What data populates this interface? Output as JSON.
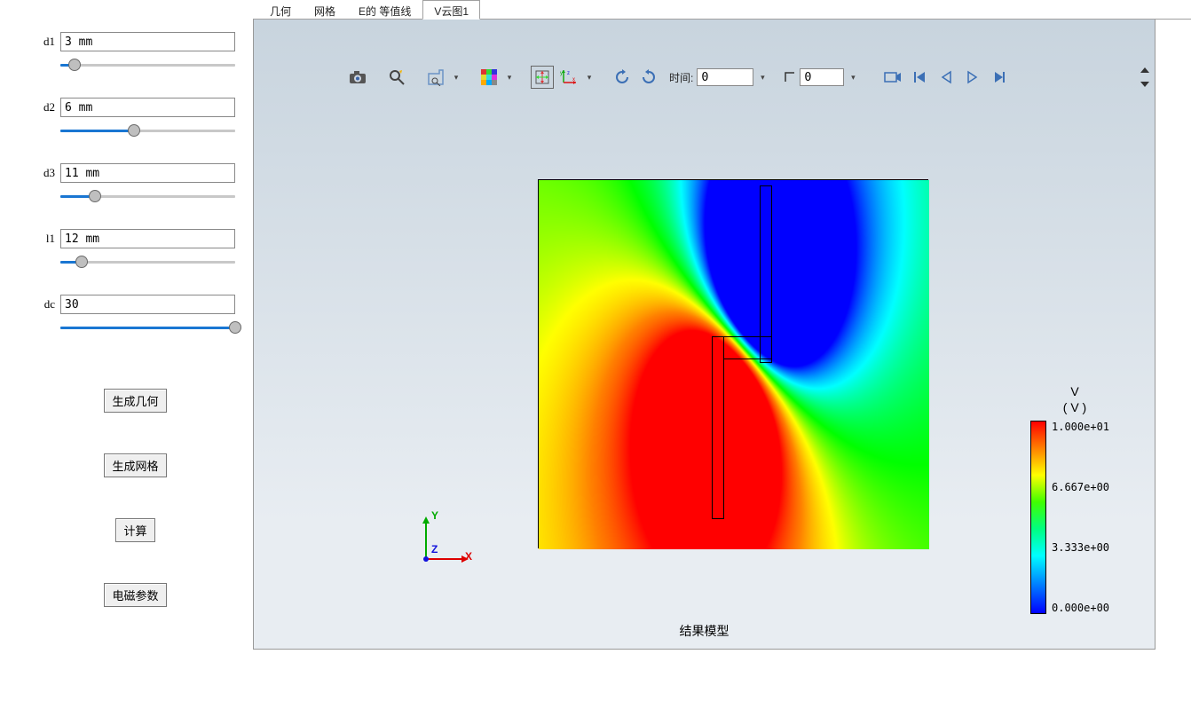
{
  "sidebar": {
    "params": [
      {
        "label": "d1",
        "value": "3 mm",
        "percent": 8
      },
      {
        "label": "d2",
        "value": "6 mm",
        "percent": 42
      },
      {
        "label": "d3",
        "value": "11 mm",
        "percent": 20
      },
      {
        "label": "l1",
        "value": "12 mm",
        "percent": 12
      },
      {
        "label": "dc",
        "value": "30",
        "percent": 100
      }
    ],
    "buttons": {
      "gen_geom": "生成几何",
      "gen_mesh": "生成网格",
      "compute": "计算",
      "em_params": "电磁参数"
    }
  },
  "tabs": [
    {
      "label": "几何",
      "active": false
    },
    {
      "label": "网格",
      "active": false
    },
    {
      "label": "E的 等值线",
      "active": false
    },
    {
      "label": "V云图1",
      "active": true
    }
  ],
  "toolbar": {
    "time_label": "时间:",
    "time_value": "0",
    "frame_value": "0",
    "icons": {
      "camera": "camera-icon",
      "zoom": "zoom-icon",
      "probe": "probe-icon",
      "palette": "palette-icon",
      "fit": "fit-icon",
      "axes": "axes-icon",
      "rot_ccw": "rotate-ccw-icon",
      "rot_cw": "rotate-cw-icon",
      "movie": "movie-icon",
      "first": "first-frame-icon",
      "prev": "prev-frame-icon",
      "play": "play-icon",
      "next": "next-frame-icon"
    }
  },
  "triad": {
    "x": "X",
    "y": "Y",
    "z": "Z"
  },
  "colorbar": {
    "title_line1": "V",
    "title_line2": "( V )",
    "ticks": [
      "1.000e+01",
      "6.667e+00",
      "3.333e+00",
      "0.000e+00"
    ]
  },
  "caption": "结果模型",
  "chart_data": {
    "type": "heatmap",
    "title": "V云图1 — 结果模型",
    "variable": "V",
    "unit": "V",
    "value_range": [
      0.0,
      10.0
    ],
    "colorbar_ticks": [
      0.0,
      3.333,
      6.667,
      10.0
    ],
    "domain": {
      "shape": "square",
      "caption": "结果模型"
    },
    "features": [
      {
        "name": "positive-electrode",
        "shape": "vertical-bar",
        "approx_center_frac": [
          0.46,
          0.65
        ],
        "approx_value": 10.0
      },
      {
        "name": "negative-electrode",
        "shape": "vertical-bar",
        "approx_center_frac": [
          0.58,
          0.26
        ],
        "approx_value": 0.0
      }
    ],
    "qualitative": "Hot red plume around lower-left electrode (≈10 V) transitioning through yellow/green/cyan to deep blue (≈0 V) in upper-right quadrant around second electrode; gradient forms an S-shaped saddle between the two bars."
  }
}
